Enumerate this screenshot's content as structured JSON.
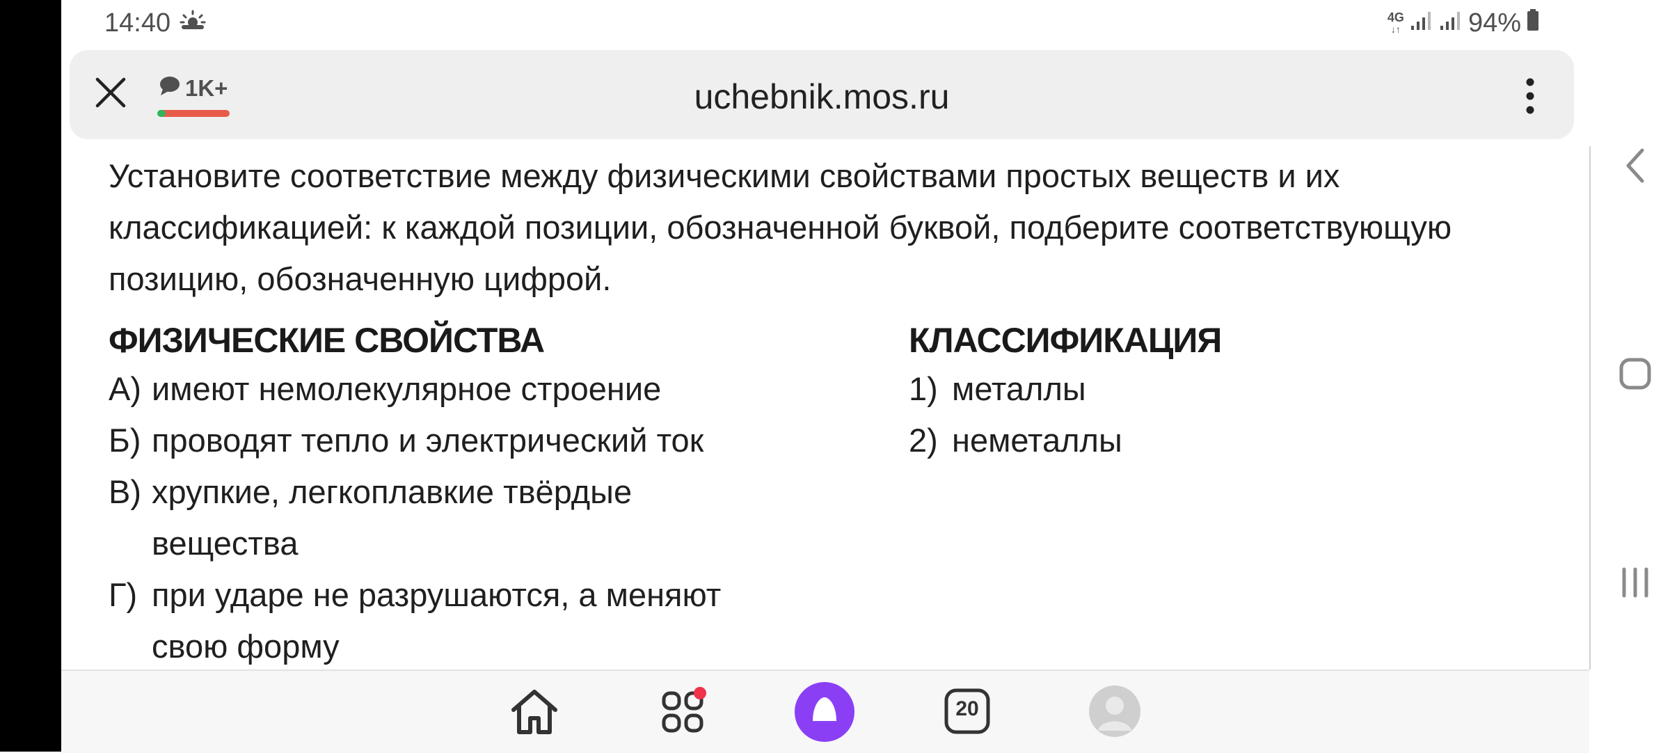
{
  "status_bar": {
    "time": "14:40",
    "weather_icon": "sun-cloud-icon",
    "network": "4G",
    "battery": "94%"
  },
  "browser": {
    "url": "uchebnik.mos.ru",
    "comments_count": "1K+"
  },
  "content": {
    "intro": "Установите соответствие между физическими свойствами простых веществ и их классификацией: к каждой позиции, обозначенной буквой, подберите соответствующую позицию, обозначенную цифрой.",
    "left_header": "ФИЗИЧЕСКИЕ СВОЙСТВА",
    "left_items": [
      {
        "key": "А)",
        "text": "имеют немолекулярное строение"
      },
      {
        "key": "Б)",
        "text": "проводят тепло и электрический ток"
      },
      {
        "key": "В)",
        "text": "хрупкие, легкоплавкие твёрдые вещества"
      },
      {
        "key": "Г)",
        "text": "при ударе не разрушаются, а меняют свою форму"
      }
    ],
    "right_header": "КЛАССИФИКАЦИЯ",
    "right_items": [
      {
        "key": "1)",
        "text": "металлы"
      },
      {
        "key": "2)",
        "text": "неметаллы"
      }
    ]
  },
  "bottom_nav": {
    "tabs_count": "20",
    "apps_has_notification": true,
    "accent_color": "#8b3ff5"
  }
}
